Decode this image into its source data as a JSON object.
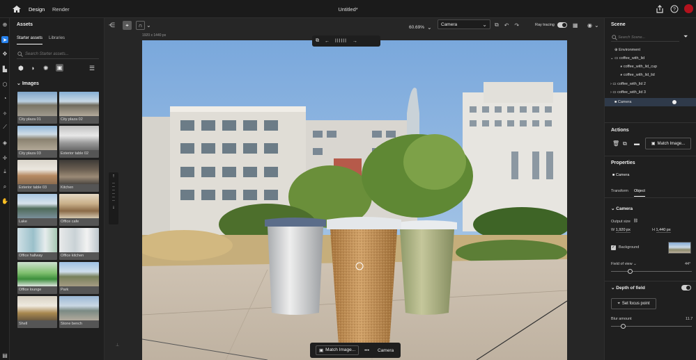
{
  "app": {
    "tabs": [
      "Design",
      "Render"
    ],
    "title": "Untitled*"
  },
  "assets": {
    "title": "Assets",
    "subtabs": [
      "Starter assets",
      "Libraries"
    ],
    "search_placeholder": "Search Starter assets...",
    "section": "Images",
    "images": [
      "City plaza 01",
      "City plaza 02",
      "City plaza 03",
      "Exterior table 02",
      "Exterior table 03",
      "Kitchen",
      "Lake",
      "Office cafe",
      "Office hallway",
      "Office kitchen",
      "Office lounge",
      "Park",
      "Shell",
      "Stone bench"
    ]
  },
  "canvas": {
    "zoom": "60.69%",
    "view": "Camera",
    "ray_tracing_label": "Ray tracing",
    "dims": "1920 x 1440 px",
    "bottom_match": "Match Image...",
    "bottom_more": "•••",
    "bottom_camera": "Camera"
  },
  "scene": {
    "title": "Scene",
    "search_placeholder": "Search Scene...",
    "items": [
      {
        "label": "Environment"
      },
      {
        "label": "coffee_with_lid"
      },
      {
        "label": "coffee_with_lid_cup"
      },
      {
        "label": "coffee_with_lid_lid"
      },
      {
        "label": "coffee_with_lid 2"
      },
      {
        "label": "coffee_with_lid 3"
      },
      {
        "label": "Camera"
      }
    ]
  },
  "actions": {
    "title": "Actions",
    "match_label": "Match Image..."
  },
  "properties": {
    "title": "Properties",
    "object_label": "Camera",
    "tabs": [
      "Transform",
      "Object"
    ],
    "camera_section": "Camera",
    "output_size_label": "Output size",
    "w_label": "W",
    "w_value": "1,920 px",
    "h_label": "H",
    "h_value": "1,440 px",
    "background_label": "Background",
    "fov_label": "Field of view",
    "fov_value": "44°",
    "fov_fraction": 0.24,
    "dof_section": "Depth of field",
    "focus_button": "Set focus point",
    "blur_label": "Blur amount",
    "blur_value": "11.7",
    "blur_fraction": 0.15
  },
  "colors": {
    "accent": "#2680eb",
    "selection": "#2f3a4a",
    "avatar": "#b3121d"
  }
}
